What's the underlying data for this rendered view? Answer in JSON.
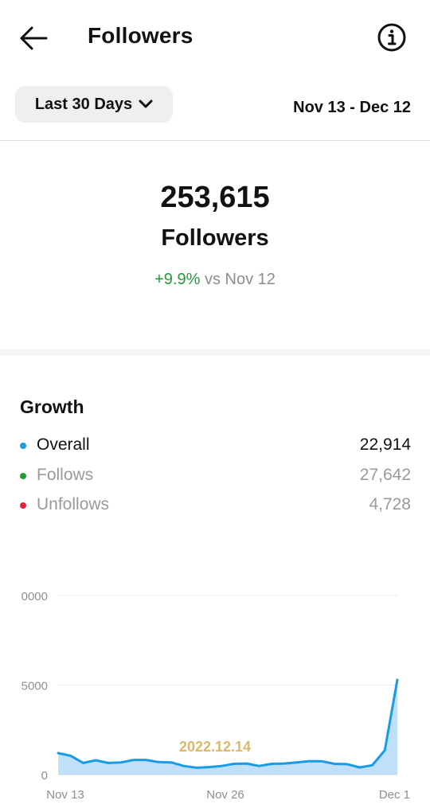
{
  "header": {
    "title": "Followers",
    "back_icon": "arrow-left-icon",
    "info_icon": "info-circle-icon"
  },
  "filter": {
    "range_label": "Last 30 Days",
    "range_icon": "chevron-down-icon",
    "date_range": "Nov 13 - Dec 12"
  },
  "summary": {
    "total": "253,615",
    "label": "Followers",
    "change_pct": "+9.9%",
    "change_suffix": " vs Nov 12"
  },
  "growth": {
    "title": "Growth",
    "rows": [
      {
        "label": "Overall",
        "value": "22,914",
        "color": "#1a9be6"
      },
      {
        "label": "Follows",
        "value": "27,642",
        "color": "#1f9b3c"
      },
      {
        "label": "Unfollows",
        "value": "4,728",
        "color": "#e0263d"
      }
    ]
  },
  "chart_data": {
    "type": "area",
    "x_ticks": [
      "Nov 13",
      "Nov 26",
      "Dec 1"
    ],
    "y_ticks": [
      "0",
      "5000",
      "0000"
    ],
    "ylim": [
      0,
      10000
    ],
    "grid": true,
    "annotation": "2022.12.14",
    "series": [
      {
        "values": [
          1200,
          1050,
          650,
          800,
          650,
          680,
          820,
          820,
          700,
          680,
          480,
          380,
          420,
          480,
          600,
          620,
          480,
          600,
          620,
          680,
          750,
          740,
          600,
          580,
          400,
          520,
          1350,
          5300
        ]
      }
    ]
  },
  "colors": {
    "accent": "#1a9be6",
    "area_fill": "#b9dcf7",
    "positive": "#1f9b3c",
    "negative": "#e0263d",
    "annotation": "#dcb86a"
  }
}
